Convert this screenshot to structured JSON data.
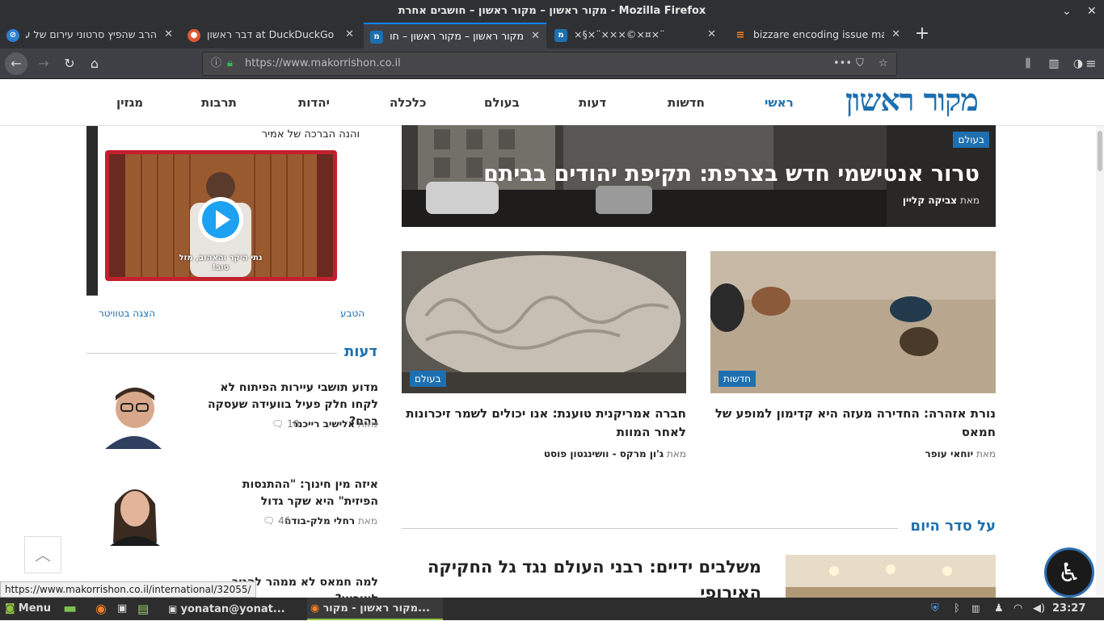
{
  "window": {
    "title": "מקור ראשון – מקור ראשון – חושבים אחרת - Mozilla Firefox"
  },
  "tabs": [
    {
      "label": "הרב שהפיץ סרטוני עירום של עד",
      "icon": "no-entry-icon"
    },
    {
      "label": "דבר ראשון at DuckDuckGo",
      "icon": "duckduckgo-icon"
    },
    {
      "label": "מקור ראשון – מקור ראשון – חוש",
      "icon": "makor-rishon-icon"
    },
    {
      "label": "×§×¨×××©×¤×¨",
      "icon": "makor-rishon-icon"
    },
    {
      "label": "bizzare encoding issue make",
      "icon": "stackoverflow-icon"
    }
  ],
  "url": {
    "value": "https://www.makorrishon.co.il",
    "dots": "•••"
  },
  "site": {
    "logo": "מקור ראשון",
    "nav": [
      "ראשי",
      "חדשות",
      "דעות",
      "בעולם",
      "כלכלה",
      "יהדות",
      "תרבות",
      "מגזין"
    ]
  },
  "hero": {
    "category": "בעולם",
    "title": "טרור אנטישמי חדש בצרפת: תקיפת יהודים בביתם",
    "by": "מאת",
    "author": "צביקה קליין"
  },
  "cards": [
    {
      "category": "חדשות",
      "title": "נורת אזהרה: החדירה מעזה היא קדימון למופע של חמאס",
      "by": "מאת",
      "author": "יוחאי עופר"
    },
    {
      "category": "בעולם",
      "title": "חברה אמריקנית טוענת: אנו יכולים לשמר זיכרונות לאחר המוות",
      "by": "מאת",
      "author": "ג'ון מרקס - וושינגטון פוסט"
    }
  ],
  "agenda": {
    "section_title": "על סדר היום",
    "headline": "משלבים ידיים: רבני העולם נגד גל החקיקה האירופי"
  },
  "sidebar": {
    "tweet_text": "והנה הברכה של אמיר",
    "video_caption": "נתי היקר והאהוב, מזל טוב!",
    "tweet_left_link": "הצגה בטוויטר",
    "tweet_right_link": "הטבע",
    "opinions_title": "דעות",
    "opinions": [
      {
        "title": "מדוע תושבי עיירות הפיתוח לא לקחו חלק פעיל בוועידה שעסקה בהם?",
        "by": "מאת",
        "author": "אלישיב רייכנר",
        "comments": "10"
      },
      {
        "title": "איזה מין חינוך: \"ההתנסות הפיזית\" היא שקר גדול",
        "by": "מאת",
        "author": "רחלי מלק-בודה",
        "comments": "46"
      },
      {
        "title": "למה חמאס לא ממהר להגיב לאירוע?",
        "by": "",
        "author": "",
        "comments": ""
      }
    ]
  },
  "status_url": "https://www.makorrishon.co.il/international/32055/",
  "taskbar": {
    "menu": "Menu",
    "terminal": "yonatan@yonat...",
    "firefox": "מקור ראשון - מקור...",
    "time": "23:27"
  }
}
